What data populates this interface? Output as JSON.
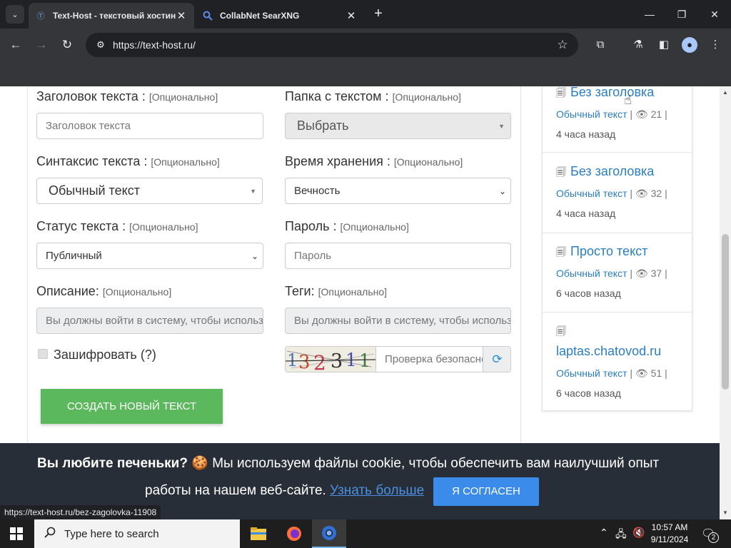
{
  "browser": {
    "tabs": [
      {
        "title": "Text-Host - текстовый хостинг",
        "active": true
      },
      {
        "title": "CollabNet SearXNG",
        "active": false
      }
    ],
    "url": "https://text-host.ru/",
    "status_url": "https://text-host.ru/bez-zagolovka-11908"
  },
  "form": {
    "optional": "[Опционально]",
    "title_label": "Заголовок текста :",
    "title_placeholder": "Заголовок текста",
    "folder_label": "Папка с текстом :",
    "folder_value": "Выбрать",
    "syntax_label": "Синтаксис текста :",
    "syntax_value": "Обычный текст",
    "expiry_label": "Время хранения :",
    "expiry_value": "Вечность",
    "status_label": "Статус текста :",
    "status_value": "Публичный",
    "password_label": "Пароль :",
    "password_placeholder": "Пароль",
    "description_label": "Описание:",
    "description_placeholder": "Вы должны войти в систему, чтобы использовать",
    "tags_label": "Теги:",
    "tags_placeholder": "Вы должны войти в систему, чтобы использовать",
    "encrypt_label": "Зашифровать",
    "encrypt_help": "(?)",
    "captcha_text": "132311",
    "captcha_placeholder": "Проверка безопасности",
    "submit_label": "СОЗДАТЬ НОВЫЙ ТЕКСТ"
  },
  "sidebar": {
    "items": [
      {
        "title": "Без заголовка",
        "syntax": "Обычный текст",
        "views": "21",
        "ago": "4 часа назад"
      },
      {
        "title": "Без заголовка",
        "syntax": "Обычный текст",
        "views": "32",
        "ago": "4 часа назад"
      },
      {
        "title": "Просто текст",
        "syntax": "Обычный текст",
        "views": "37",
        "ago": "6 часов назад"
      },
      {
        "title": "laptas.chatovod.ru",
        "syntax": "Обычный текст",
        "views": "51",
        "ago": "6 часов назад"
      }
    ]
  },
  "cookie": {
    "heading": "Вы любите печеньки?",
    "text1": "Мы используем файлы cookie, чтобы обеспечить вам наилучший опыт",
    "text2": "работы на нашем веб-сайте.",
    "learn_more": "Узнать больше",
    "agree": "Я СОГЛАСЕН"
  },
  "taskbar": {
    "search_placeholder": "Type here to search",
    "time": "10:57 AM",
    "date": "9/11/2024",
    "notifications": "2"
  },
  "colors": {
    "accent_green": "#5cb85c",
    "link_blue": "#2b7ec1",
    "agree_blue": "#3b8beb"
  }
}
